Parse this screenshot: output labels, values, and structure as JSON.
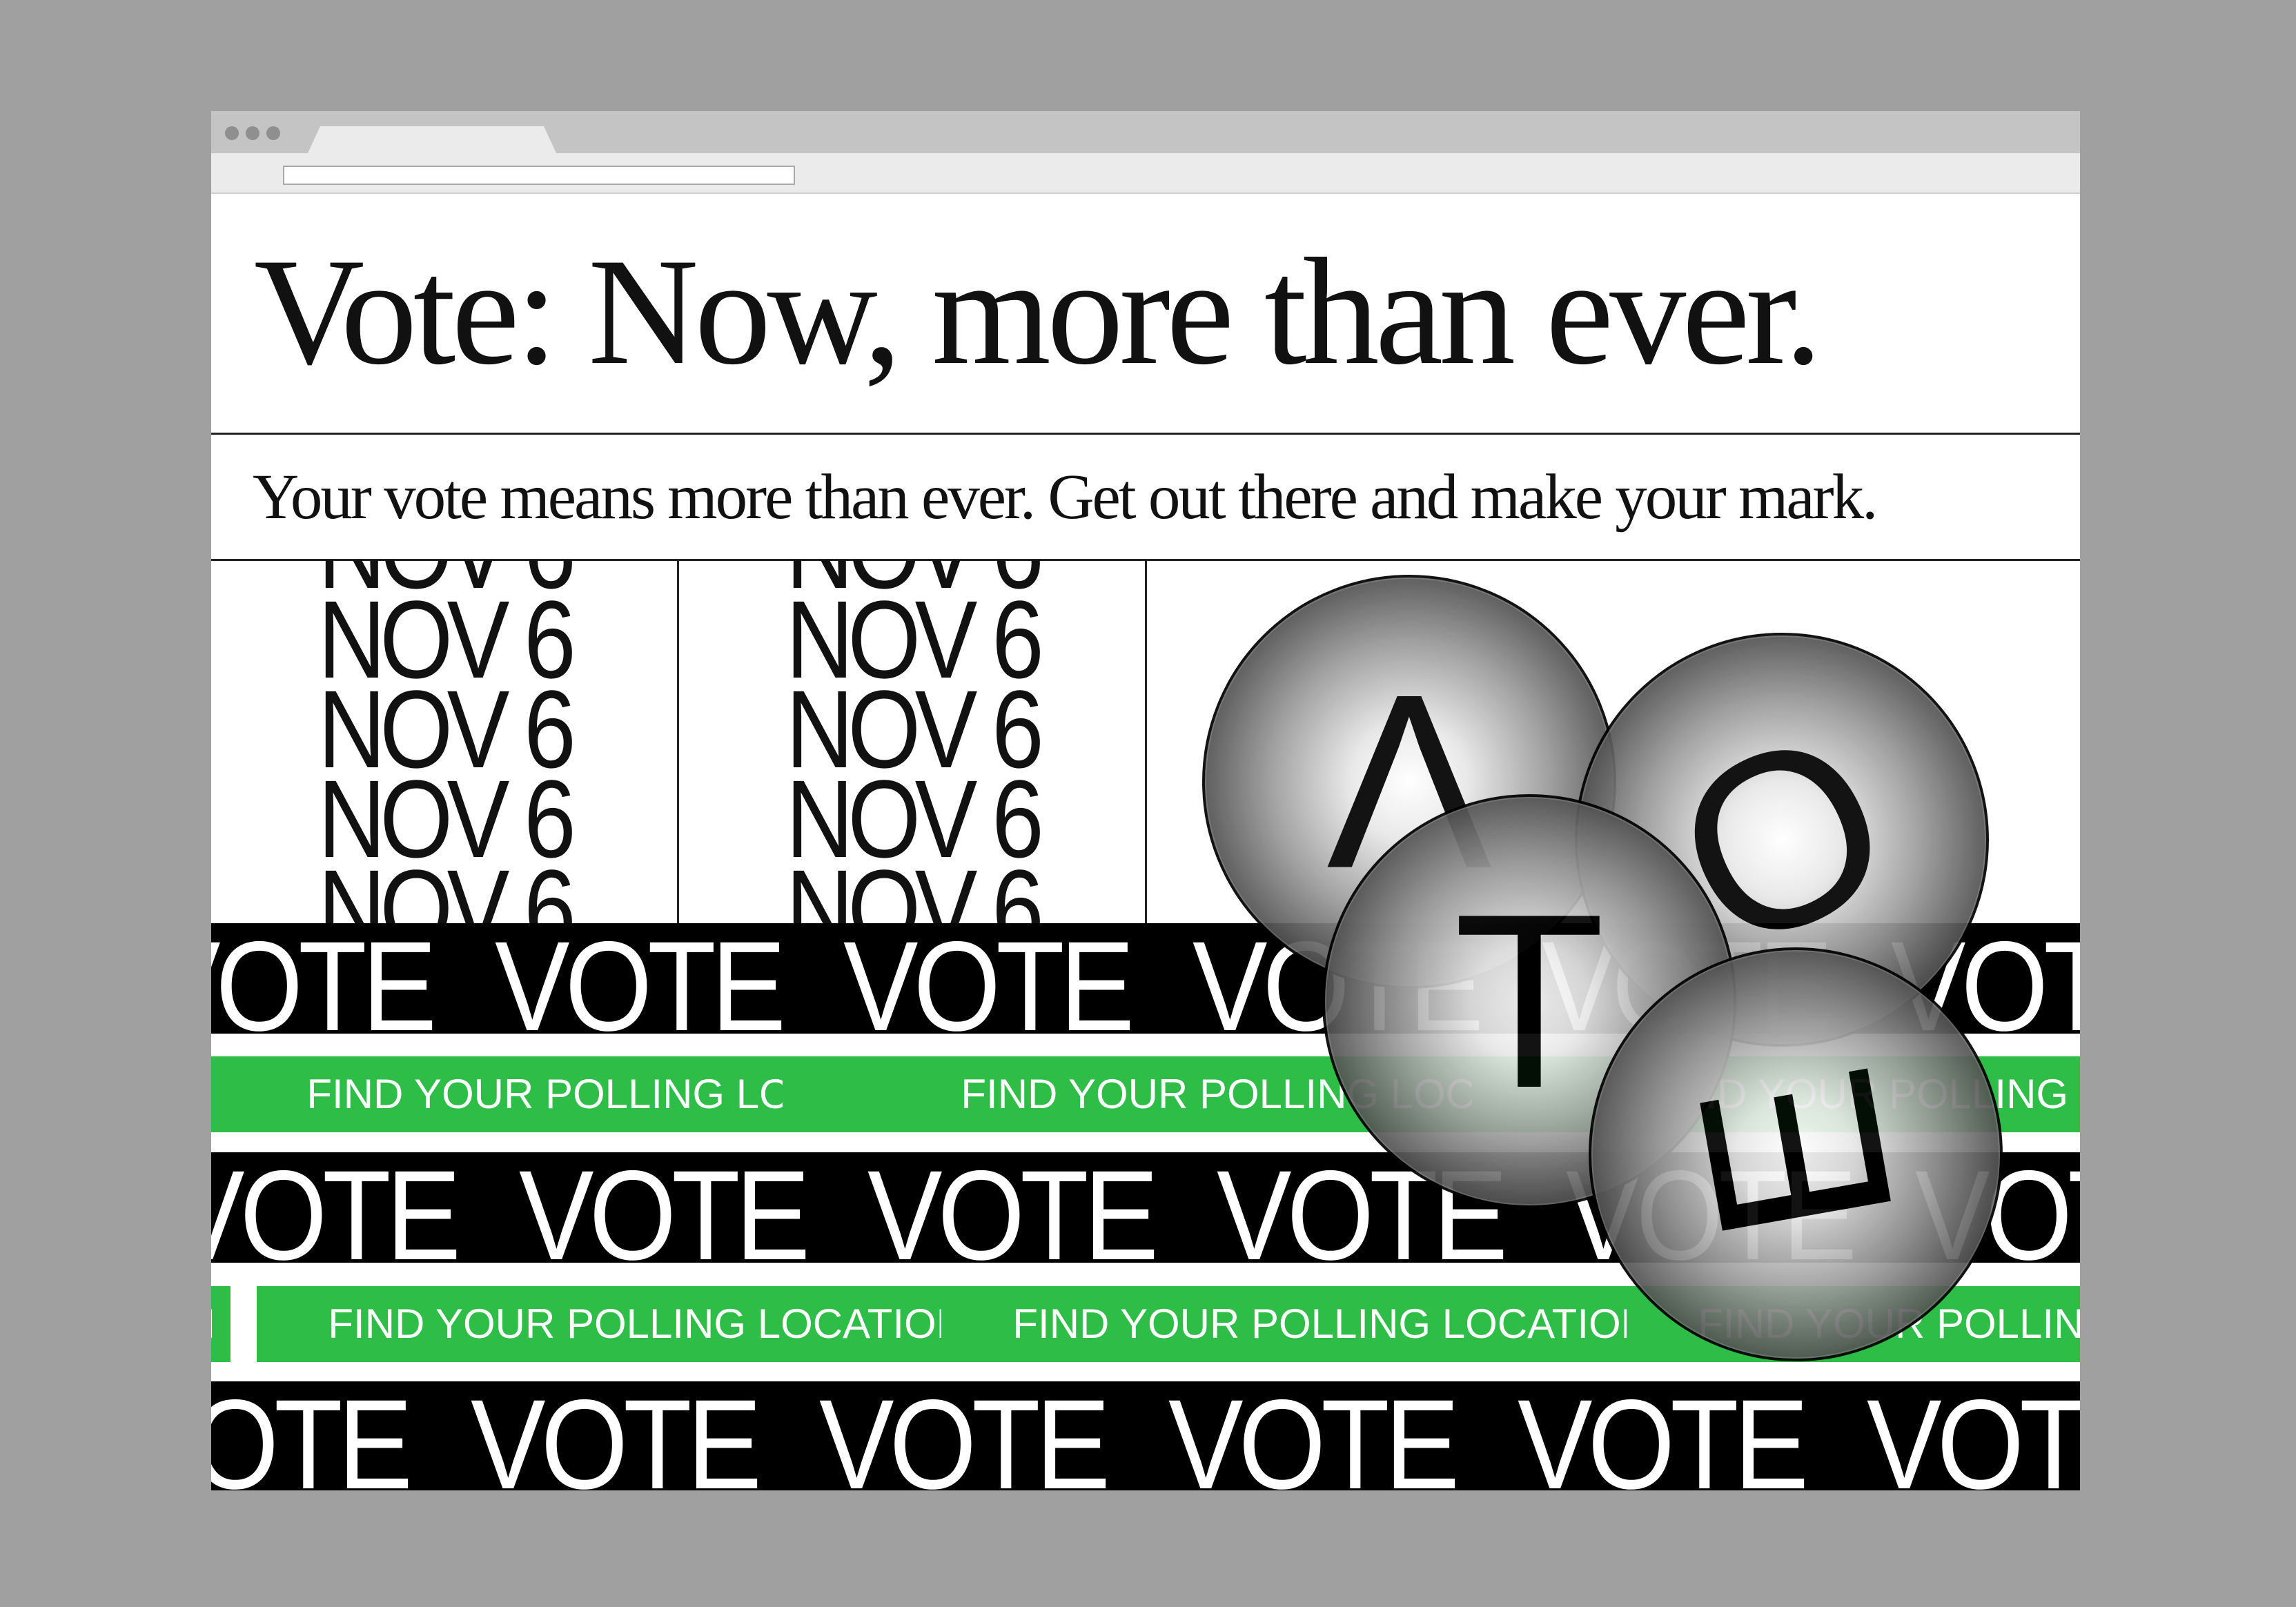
{
  "page": {
    "headline": "Vote: Now, more than ever.",
    "subline": "Your vote means more than ever. Get out there and make your mark."
  },
  "dates": {
    "label": "NOV 6"
  },
  "ticker": {
    "vote_word": "VOTE",
    "polling_label": "FIND YOUR POLLING LOCATION"
  },
  "orbs": {
    "letters": [
      "V",
      "O",
      "T",
      "E"
    ]
  },
  "colors": {
    "background": "#a0a0a0",
    "accent_green": "#2ebd47",
    "strip_black": "#000000",
    "page_white": "#ffffff"
  },
  "icons": {
    "window_controls": "three-dots-icon"
  }
}
